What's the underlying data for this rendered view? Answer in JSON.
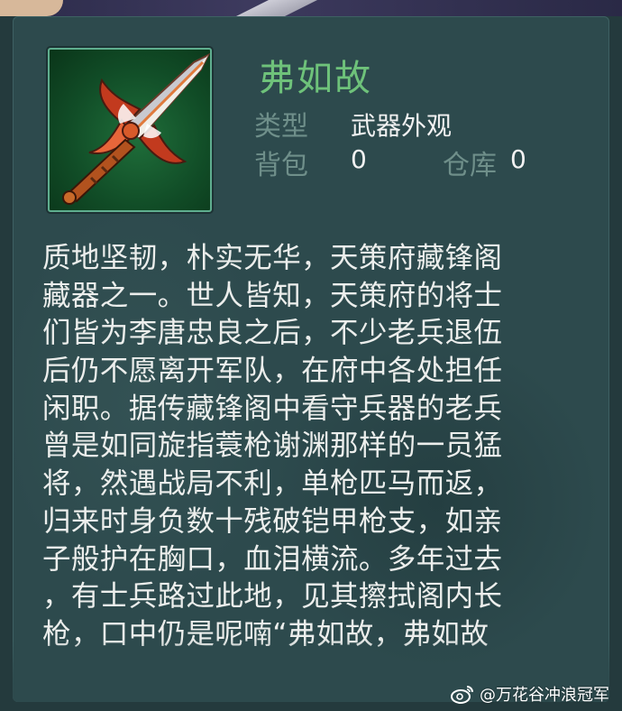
{
  "item": {
    "name": "弗如故",
    "type_label": "类型",
    "type_value": "武器外观",
    "bag_label": "背包",
    "bag_value": "0",
    "storage_label": "仓库",
    "storage_value": "0",
    "icon": "sword-icon"
  },
  "description_lines": [
    "质地坚韧，朴实无华，天策府藏锋阁",
    "藏器之一。世人皆知，天策府的将士",
    "们皆为李唐忠良之后，不少老兵退伍",
    "后仍不愿离开军队，在府中各处担任",
    "闲职。据传藏锋阁中看守兵器的老兵",
    "曾是如同旋指蓑枪谢渊那样的一员猛",
    "将，然遇战局不利，单枪匹马而返，",
    "归来时身负数十残破铠甲枪支，如亲",
    "子般护在胸口，血泪横流。多年过去",
    "，有士兵路过此地，见其擦拭阁内长",
    "枪，口中仍是呢喃“弗如故，弗如故"
  ],
  "watermark": "@万花谷冲浪冠军",
  "colors": {
    "title": "#6ec27a",
    "label": "#6f8f8a",
    "value": "#f2f2f2",
    "panel": "#2d4a4d"
  }
}
